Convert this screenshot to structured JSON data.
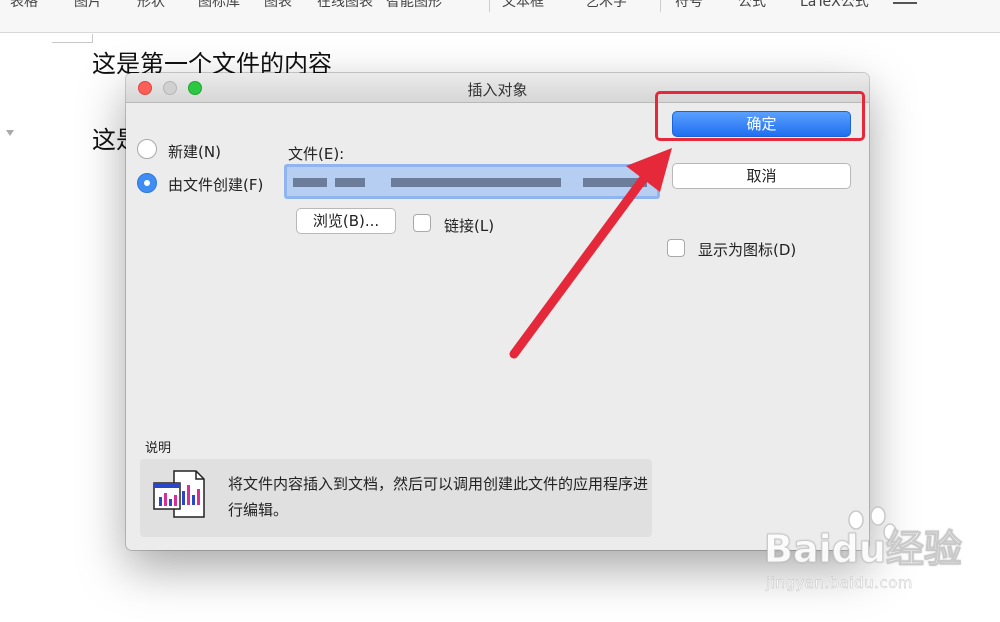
{
  "toolbar": {
    "items": [
      "表格",
      "图片",
      "形状",
      "图标库",
      "图表",
      "在线图表",
      "智能图形",
      "文本框",
      "艺术字",
      "符号",
      "公式",
      "LaTeX公式"
    ]
  },
  "document": {
    "line1": "这是第一个文件的内容",
    "line2": "这是"
  },
  "dialog": {
    "title": "插入对象",
    "option_new": "新建(N)",
    "option_from_file": "由文件创建(F)",
    "file_label": "文件(E):",
    "browse_button": "浏览(B)...",
    "link_label": "链接(L)",
    "ok_button": "确定",
    "cancel_button": "取消",
    "display_as_icon_label": "显示为图标(D)",
    "description_heading": "说明",
    "description_text": "将文件内容插入到文档，然后可以调用创建此文件的应用程序进行编辑。",
    "selected_option": "由文件创建(F)"
  },
  "annotation": {
    "color": "#e5283a"
  },
  "watermark": {
    "logo_text": "Baidu经验",
    "url": "jingyan.baidu.com"
  }
}
